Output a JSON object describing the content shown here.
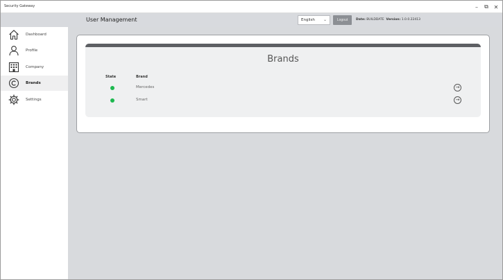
{
  "window": {
    "title": "Security Gateway",
    "controls": {
      "minimize": "–",
      "maximize": "⧉",
      "close": "✕"
    }
  },
  "header": {
    "page_title": "User Management",
    "language": "English",
    "logout_label": "Logout",
    "date_label": "Date:",
    "date_value": "BUILDDATE",
    "version_label": "Version:",
    "version_value": "1.0.0.22413"
  },
  "sidebar": {
    "items": [
      {
        "label": "Dashboard",
        "icon": "home-icon",
        "active": false
      },
      {
        "label": "Profile",
        "icon": "person-icon",
        "active": false
      },
      {
        "label": "Company",
        "icon": "building-icon",
        "active": false
      },
      {
        "label": "Brands",
        "icon": "copyright-icon",
        "active": true
      },
      {
        "label": "Settings",
        "icon": "gear-icon",
        "active": false
      }
    ]
  },
  "brands": {
    "title": "Brands",
    "columns": {
      "state": "State",
      "brand": "Brand"
    },
    "rows": [
      {
        "brand": "Mercedes",
        "state_color": "#1db84f"
      },
      {
        "brand": "Smart",
        "state_color": "#1db84f"
      }
    ]
  }
}
